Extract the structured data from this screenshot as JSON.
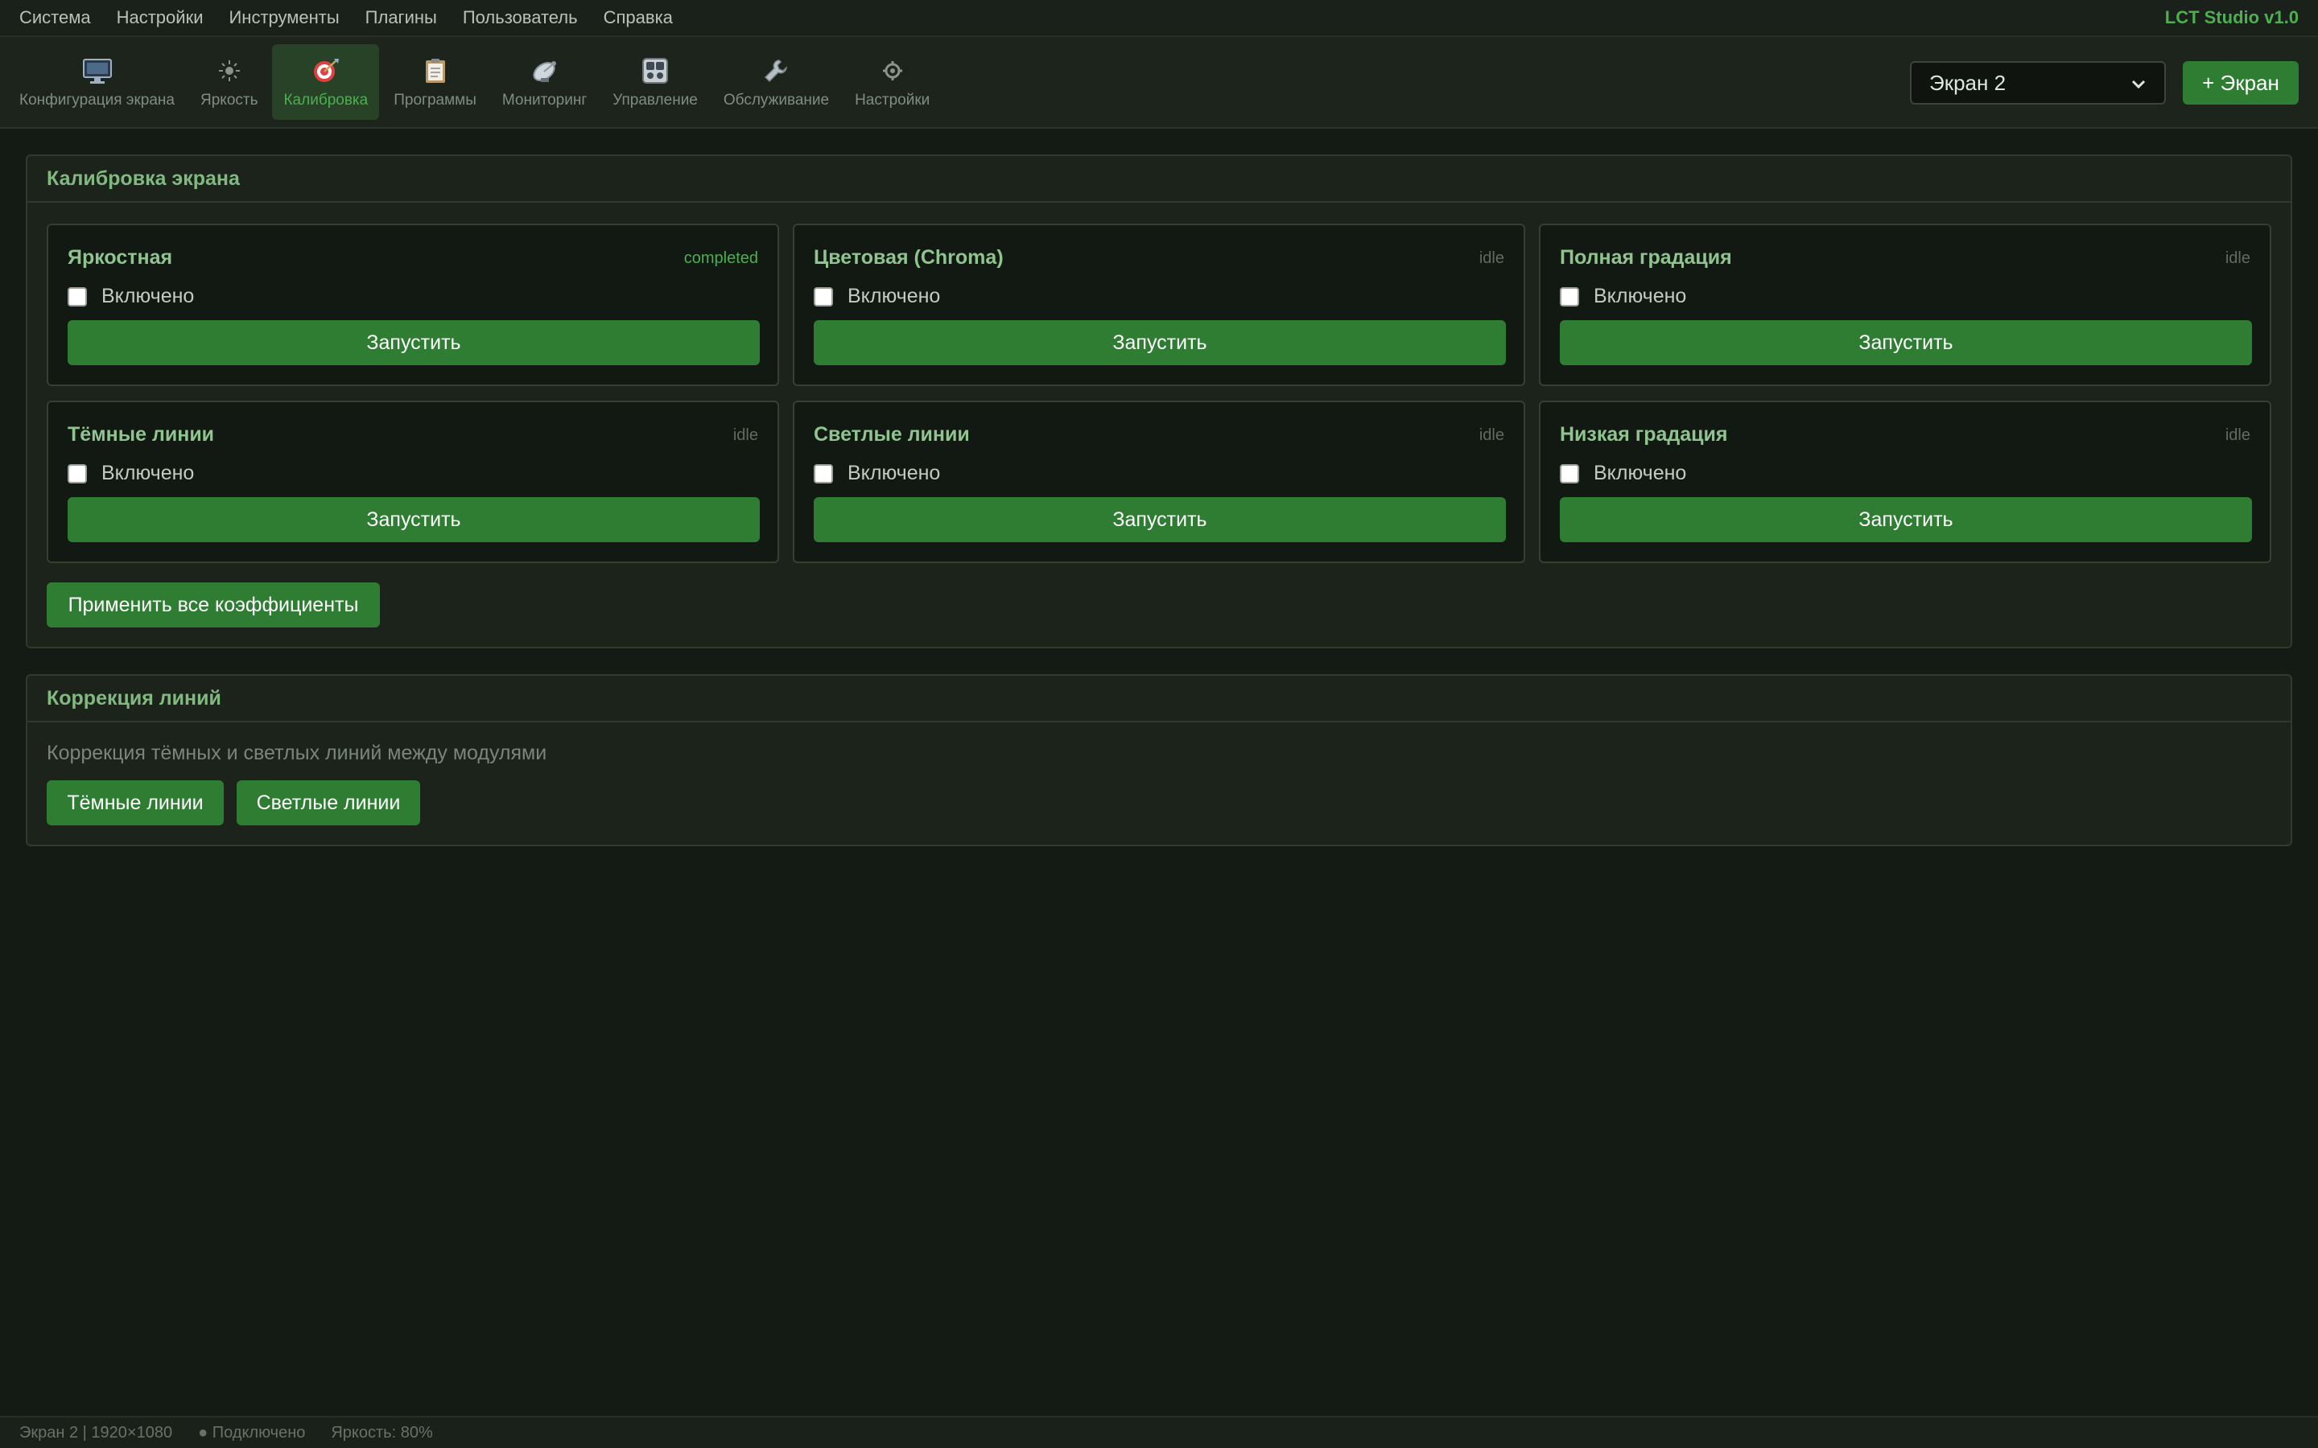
{
  "menu": {
    "items": [
      "Система",
      "Настройки",
      "Инструменты",
      "Плагины",
      "Пользователь",
      "Справка"
    ],
    "app_title": "LCT Studio v1.0"
  },
  "toolbar": {
    "tabs": [
      {
        "label": "Конфигурация экрана",
        "icon": "monitor-icon"
      },
      {
        "label": "Яркость",
        "icon": "sun-icon"
      },
      {
        "label": "Калибровка",
        "icon": "target-icon",
        "active": true
      },
      {
        "label": "Программы",
        "icon": "clipboard-icon"
      },
      {
        "label": "Мониторинг",
        "icon": "satellite-icon"
      },
      {
        "label": "Управление",
        "icon": "control-panel-icon"
      },
      {
        "label": "Обслуживание",
        "icon": "wrench-icon"
      },
      {
        "label": "Настройки",
        "icon": "gear-icon"
      }
    ],
    "screen_select": "Экран 2",
    "add_screen": "+ Экран"
  },
  "calibration": {
    "title": "Калибровка экрана",
    "cards": [
      {
        "title": "Яркостная",
        "status": "completed",
        "checkbox_label": "Включено",
        "button": "Запустить"
      },
      {
        "title": "Цветовая (Chroma)",
        "status": "idle",
        "checkbox_label": "Включено",
        "button": "Запустить"
      },
      {
        "title": "Полная градация",
        "status": "idle",
        "checkbox_label": "Включено",
        "button": "Запустить"
      },
      {
        "title": "Тёмные линии",
        "status": "idle",
        "checkbox_label": "Включено",
        "button": "Запустить"
      },
      {
        "title": "Светлые линии",
        "status": "idle",
        "checkbox_label": "Включено",
        "button": "Запустить"
      },
      {
        "title": "Низкая градация",
        "status": "idle",
        "checkbox_label": "Включено",
        "button": "Запустить"
      }
    ],
    "apply_all": "Применить все коэффициенты"
  },
  "line_correction": {
    "title": "Коррекция линий",
    "description": "Коррекция тёмных и светлых линий между модулями",
    "dark_button": "Тёмные линии",
    "light_button": "Светлые линии"
  },
  "statusbar": {
    "screen": "Экран 2 | 1920×1080",
    "connection": "● Подключено",
    "brightness": "Яркость: 80%"
  },
  "colors": {
    "accent": "#2e7d32",
    "accent_text": "#4caf50",
    "background": "#141a14"
  }
}
